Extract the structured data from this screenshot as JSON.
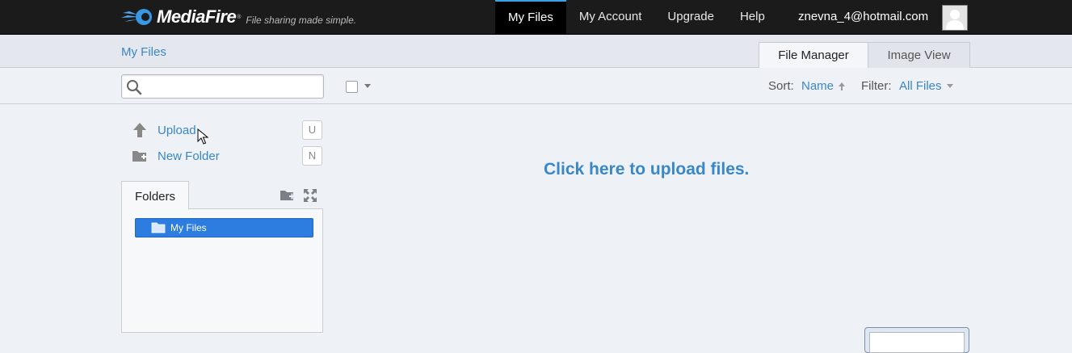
{
  "brand": {
    "name": "MediaFire",
    "tagline": "File sharing made simple.",
    "registered_mark": "®"
  },
  "nav": {
    "items": [
      {
        "label": "My Files",
        "active": true
      },
      {
        "label": "My Account",
        "active": false
      },
      {
        "label": "Upgrade",
        "active": false
      },
      {
        "label": "Help",
        "active": false
      }
    ],
    "user_email": "znevna_4@hotmail.com"
  },
  "breadcrumb": {
    "current": "My Files"
  },
  "view_tabs": [
    {
      "label": "File Manager",
      "active": true
    },
    {
      "label": "Image View",
      "active": false
    }
  ],
  "toolbar": {
    "search_placeholder": "",
    "sort_label": "Sort:",
    "sort_value": "Name",
    "filter_label": "Filter:",
    "filter_value": "All Files"
  },
  "actions": [
    {
      "label": "Upload",
      "shortcut": "U",
      "icon": "upload-arrow-icon"
    },
    {
      "label": "New Folder",
      "shortcut": "N",
      "icon": "new-folder-icon"
    }
  ],
  "folders": {
    "tab_label": "Folders",
    "items": [
      {
        "label": "My Files",
        "selected": true
      }
    ]
  },
  "main": {
    "upload_prompt": "Click here to upload files."
  },
  "colors": {
    "topbar": "#1b1b1b",
    "accent": "#3a87c8",
    "active_nav_border": "#3aa0e8",
    "selected_folder": "#2d7de0"
  }
}
